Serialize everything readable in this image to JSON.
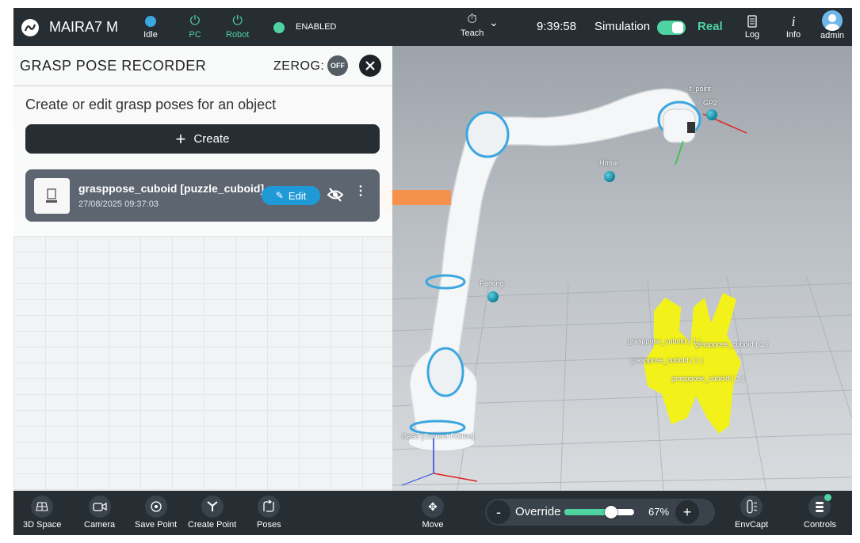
{
  "topbar": {
    "app_name": "MAIRA7 M",
    "idle_label": "Idle",
    "pc_label": "PC",
    "robot_label": "Robot",
    "enabled_label": "ENABLED",
    "teach_label": "Teach",
    "time": "9:39:58",
    "simulation_label": "Simulation",
    "real_label": "Real",
    "log_label": "Log",
    "info_label": "Info",
    "user_label": "admin"
  },
  "panel": {
    "title": "GRASP POSE RECORDER",
    "zerog_label": "ZEROG:",
    "zerog_state": "OFF",
    "subtitle": "Create or edit grasp poses for an object",
    "create_label": "Create",
    "item": {
      "name": "grasppose_cuboid [puzzle_cuboid]",
      "date": "27/08/2025 09:37:03",
      "edit_label": "Edit"
    }
  },
  "scene_labels": {
    "home": "Home",
    "parking": "Parking",
    "gp2": "GP2",
    "point": "t_point",
    "base": "Base [Current Frame]",
    "g1": "grasppose_cuboid ( 1 )",
    "g2": "grasppose_cuboid ( 1 )",
    "g3": "grasppose_cuboid ( 1 )",
    "g4": "grasppose_cuboid ( 1 )"
  },
  "bottombar": {
    "space_label": "3D Space",
    "camera_label": "Camera",
    "save_point_label": "Save Point",
    "create_point_label": "Create Point",
    "poses_label": "Poses",
    "move_label": "Move",
    "override_label": "Override",
    "override_value": "67%",
    "override_fraction": 0.67,
    "envcapt_label": "EnvCapt",
    "controls_label": "Controls"
  },
  "colors": {
    "bar_bg": "#262d33",
    "accent_teal": "#4fd3a0",
    "edit_blue": "#1f9ad6",
    "arrow_orange": "#f5914a",
    "marker_yellow": "#f2f21a"
  }
}
